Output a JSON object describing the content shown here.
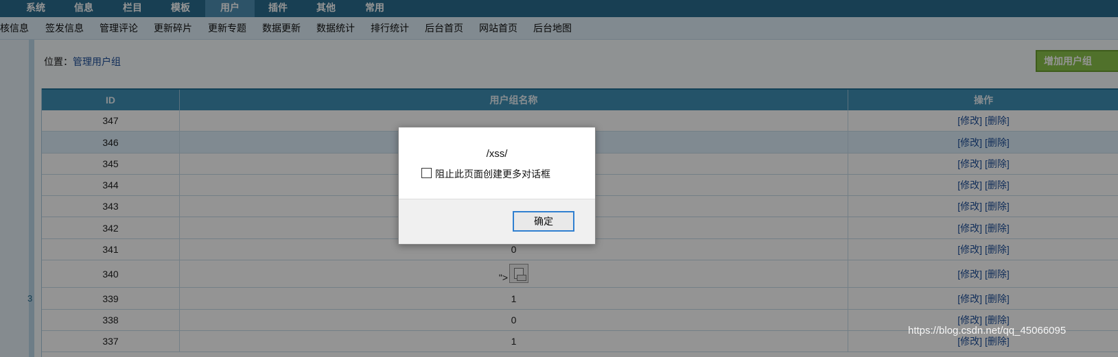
{
  "top_menu": {
    "items": [
      {
        "label": "系统"
      },
      {
        "label": "信息"
      },
      {
        "label": "栏目"
      },
      {
        "label": "模板"
      },
      {
        "label": "用户",
        "active": true
      },
      {
        "label": "插件"
      },
      {
        "label": "其他"
      },
      {
        "label": "常用"
      }
    ]
  },
  "sub_menu": {
    "items": [
      {
        "label": "审核信息"
      },
      {
        "label": "签发信息"
      },
      {
        "label": "管理评论"
      },
      {
        "label": "更新碎片"
      },
      {
        "label": "更新专题"
      },
      {
        "label": "数据更新"
      },
      {
        "label": "数据统计"
      },
      {
        "label": "排行统计"
      },
      {
        "label": "后台首页"
      },
      {
        "label": "网站首页"
      },
      {
        "label": "后台地图"
      }
    ]
  },
  "left_panel": {
    "number": "3"
  },
  "content": {
    "position_label": "位置：",
    "position_link": "管理用户组",
    "add_button": "增加用户组"
  },
  "table": {
    "headers": {
      "id": "ID",
      "name": "用户组名称",
      "ops": "操作"
    },
    "rows": [
      {
        "id": "347",
        "name": ""
      },
      {
        "id": "346",
        "name": ""
      },
      {
        "id": "345",
        "name": ""
      },
      {
        "id": "344",
        "name": ""
      },
      {
        "id": "343",
        "name": ""
      },
      {
        "id": "342",
        "name": ""
      },
      {
        "id": "341",
        "name": "0"
      },
      {
        "id": "340",
        "name": "\">"
      },
      {
        "id": "339",
        "name": "1"
      },
      {
        "id": "338",
        "name": "0"
      },
      {
        "id": "337",
        "name": "1"
      }
    ],
    "op_edit": "[修改]",
    "op_delete": "[删除]"
  },
  "dialog": {
    "message": "/xss/",
    "checkbox_label": "阻止此页面创建更多对话框",
    "ok_button": "确定"
  },
  "watermark": "https://blog.csdn.net/qq_45066095",
  "colors": {
    "top_menu_bg": "#2a6d8f",
    "header_bg": "#3f8fb6",
    "link": "#1d4f9a",
    "add_button_bg": "#8bc34a",
    "dialog_button_border": "#2f7fd0"
  }
}
